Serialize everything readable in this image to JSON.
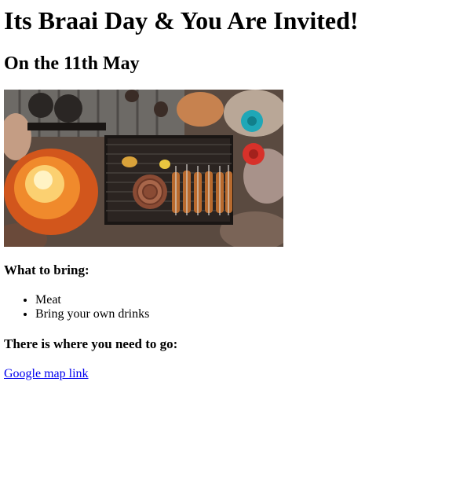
{
  "header": {
    "title": "Its Braai Day & You Are Invited!",
    "subtitle": "On the 11th May"
  },
  "bring": {
    "heading": "What to bring:",
    "items": [
      "Meat",
      "Bring your own drinks"
    ]
  },
  "location": {
    "heading": "There is where you need to go:",
    "link_label": "Google map link"
  }
}
